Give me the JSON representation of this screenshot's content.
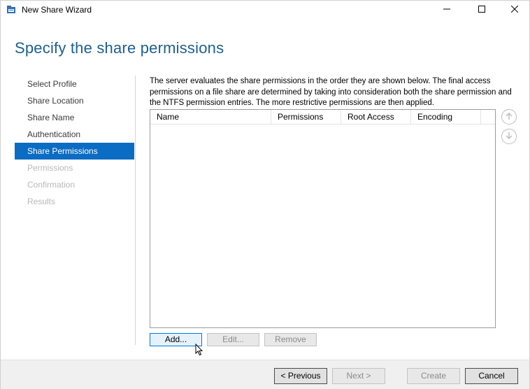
{
  "window": {
    "title": "New Share Wizard"
  },
  "page": {
    "title": "Specify the share permissions",
    "description": "The server evaluates the share permissions in the order they are shown below. The final access permissions on a file share are determined by taking into consideration both the share permission and the NTFS permission entries. The more restrictive permissions are then applied."
  },
  "nav": {
    "items": [
      {
        "label": "Select Profile",
        "state": "normal"
      },
      {
        "label": "Share Location",
        "state": "normal"
      },
      {
        "label": "Share Name",
        "state": "normal"
      },
      {
        "label": "Authentication",
        "state": "normal"
      },
      {
        "label": "Share Permissions",
        "state": "active"
      },
      {
        "label": "Permissions",
        "state": "disabled"
      },
      {
        "label": "Confirmation",
        "state": "disabled"
      },
      {
        "label": "Results",
        "state": "disabled"
      }
    ]
  },
  "table": {
    "columns": [
      "Name",
      "Permissions",
      "Root Access",
      "Encoding"
    ],
    "rows": []
  },
  "actions": {
    "add": "Add...",
    "edit": "Edit...",
    "remove": "Remove"
  },
  "footer": {
    "previous": "< Previous",
    "next": "Next >",
    "create": "Create",
    "cancel": "Cancel"
  },
  "colors": {
    "accent": "#0a6cc2",
    "title": "#1e5f8f"
  },
  "icons": {
    "app": "share-wizard-icon",
    "minimize": "minimize-icon",
    "maximize": "maximize-icon",
    "close": "close-icon",
    "move_up": "arrow-up-circle-icon",
    "move_down": "arrow-down-circle-icon",
    "cursor": "mouse-pointer-icon"
  }
}
